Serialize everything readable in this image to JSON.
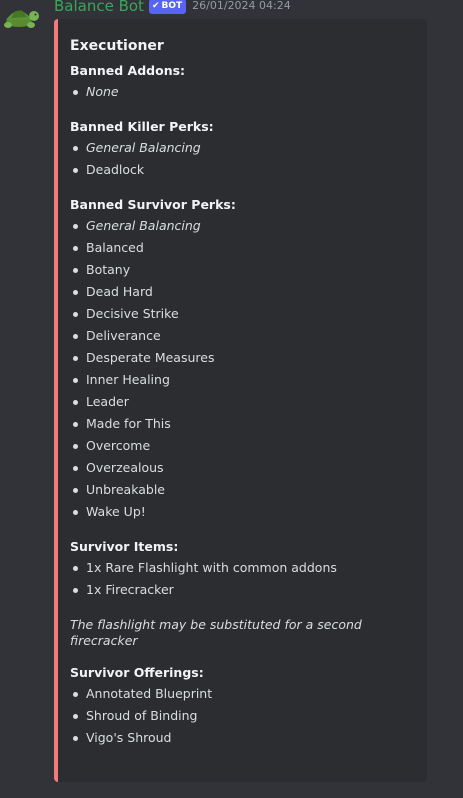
{
  "message": {
    "username": "Balance Bot",
    "bot_tag": "BOT",
    "timestamp": "26/01/2024 04:24",
    "avatar_icon": "turtle-icon",
    "accent_color": "#f47b7b",
    "username_color": "#3ba55c"
  },
  "embed": {
    "title": "Executioner",
    "banned_addons": {
      "label": "Banned Addons:",
      "items": [
        "None"
      ]
    },
    "banned_killer_perks": {
      "label": "Banned Killer Perks:",
      "items": [
        "General Balancing",
        "Deadlock"
      ]
    },
    "banned_survivor_perks": {
      "label": "Banned Survivor Perks:",
      "items": [
        "General Balancing",
        "Balanced",
        "Botany",
        "Dead Hard",
        "Decisive Strike",
        "Deliverance",
        "Desperate Measures",
        "Inner Healing",
        "Leader",
        "Made for This",
        "Overcome",
        "Overzealous",
        "Unbreakable",
        "Wake Up!"
      ]
    },
    "survivor_items": {
      "label": "Survivor Items:",
      "items": [
        "1x Rare Flashlight with common addons",
        "1x Firecracker"
      ],
      "note": "The flashlight may be substituted for a second firecracker"
    },
    "survivor_offerings": {
      "label": "Survivor Offerings:",
      "items": [
        "Annotated Blueprint",
        "Shroud of Binding",
        "Vigo's Shroud"
      ]
    }
  }
}
